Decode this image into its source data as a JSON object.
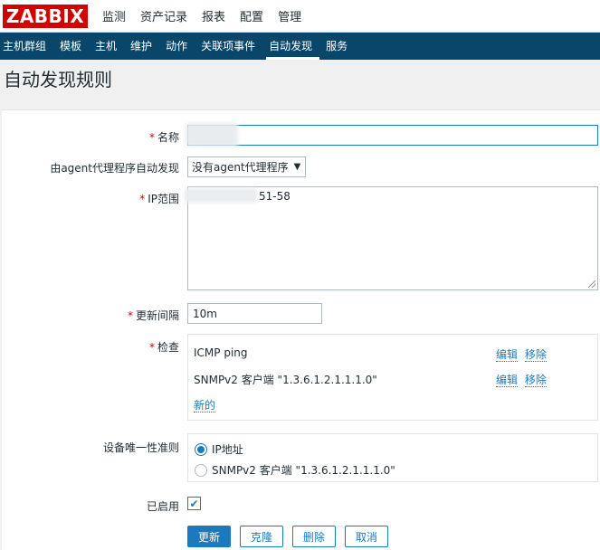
{
  "logo": "ZABBIX",
  "top_menu": [
    "监测",
    "资产记录",
    "报表",
    "配置",
    "管理"
  ],
  "sub_menu": [
    "主机群组",
    "模板",
    "主机",
    "维护",
    "动作",
    "关联项事件",
    "自动发现",
    "服务"
  ],
  "page_title": "自动发现规则",
  "form": {
    "name_label": "名称",
    "proxy_label": "由agent代理程序自动发现",
    "proxy_value": "没有agent代理程序",
    "ip_label": "IP范围",
    "ip_value_visible": "51-58",
    "interval_label": "更新间隔",
    "interval_value": "10m",
    "checks_label": "检查",
    "checks": [
      {
        "name": "ICMP ping",
        "edit": "编辑",
        "remove": "移除"
      },
      {
        "name": "SNMPv2 客户端 \"1.3.6.1.2.1.1.1.0\"",
        "edit": "编辑",
        "remove": "移除"
      }
    ],
    "new_link": "新的",
    "unique_label": "设备唯一性准则",
    "unique_options": [
      "IP地址",
      "SNMPv2 客户端 \"1.3.6.1.2.1.1.1.0\""
    ],
    "unique_selected": 0,
    "enabled_label": "已启用",
    "enabled": true
  },
  "buttons": {
    "update": "更新",
    "clone": "克隆",
    "delete": "删除",
    "cancel": "取消"
  },
  "colors": {
    "brand": "#d40000",
    "subnav": "#0a466a",
    "accent": "#1a7ac0"
  }
}
